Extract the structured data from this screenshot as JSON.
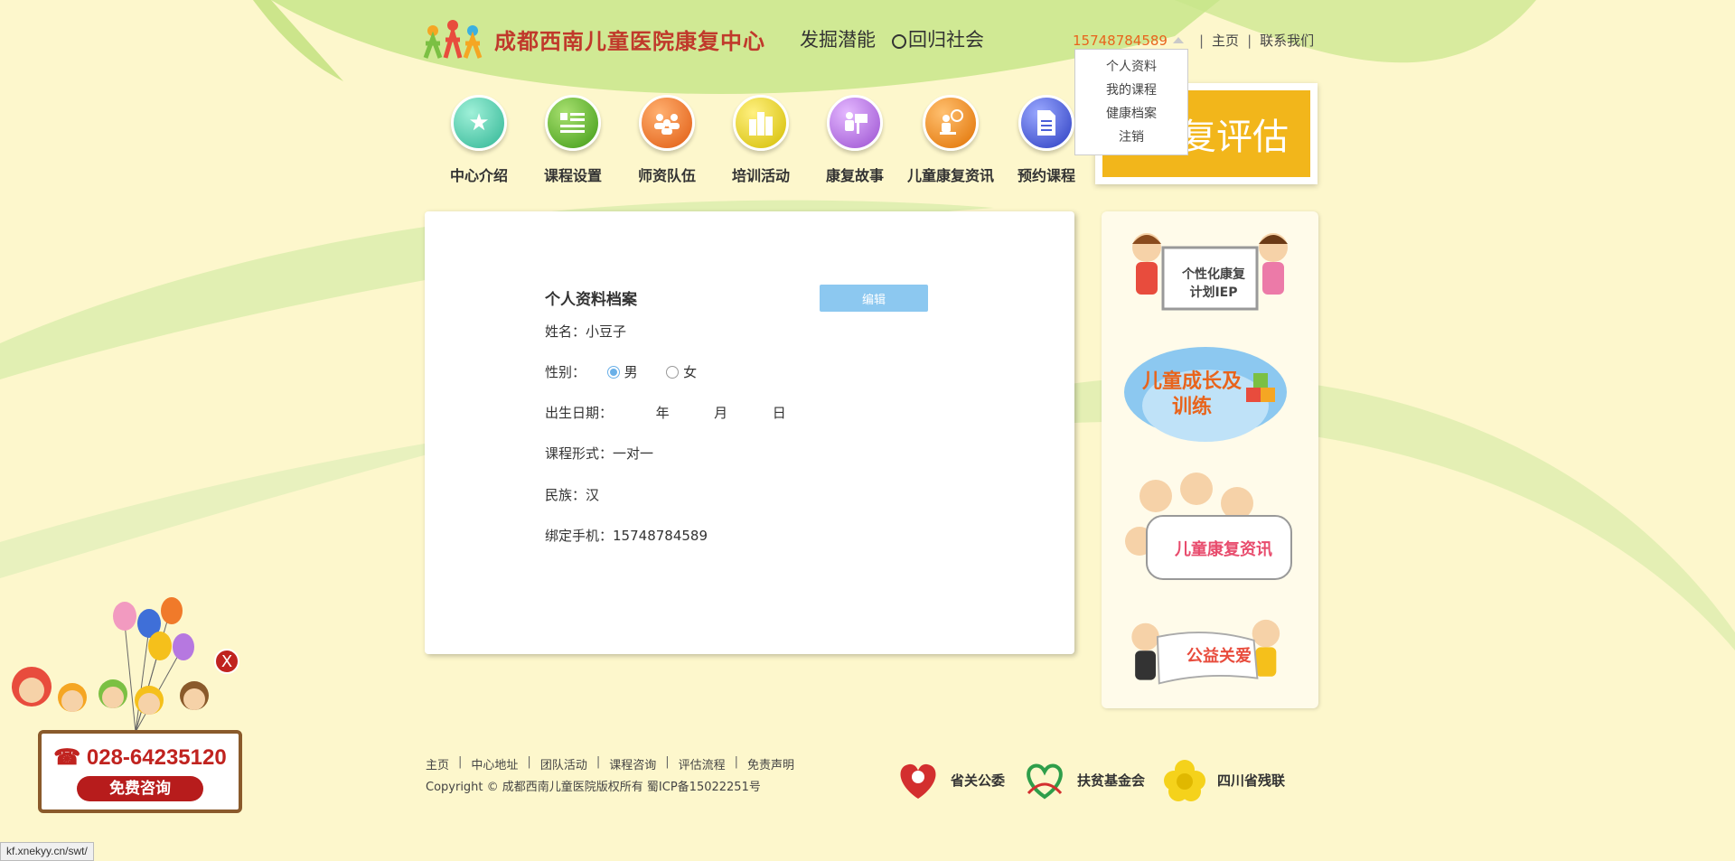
{
  "header": {
    "logo_text": "成都西南儿童医院康复中心",
    "slogan_1": "发掘潜能",
    "slogan_2": "回归社会",
    "phone": "15748784589",
    "home": "主页",
    "contact": "联系我们"
  },
  "dropdown": {
    "items": [
      "个人资料",
      "我的课程",
      "健康档案",
      "注销"
    ]
  },
  "nav": {
    "items": [
      {
        "label": "中心介绍",
        "icon": "star-icon",
        "color": "#4fc9b0"
      },
      {
        "label": "课程设置",
        "icon": "list-icon",
        "color": "#5cb82a"
      },
      {
        "label": "师资队伍",
        "icon": "team-icon",
        "color": "#f07a2a"
      },
      {
        "label": "培训活动",
        "icon": "building-icon",
        "color": "#e6d21a"
      },
      {
        "label": "康复故事",
        "icon": "story-icon",
        "color": "#b678e0"
      },
      {
        "label": "儿童康复资讯",
        "icon": "person-clock-icon",
        "color": "#f08a1a"
      },
      {
        "label": "预约课程",
        "icon": "document-icon",
        "color": "#4a5fd8"
      }
    ]
  },
  "banner": {
    "text": "复评估"
  },
  "profile": {
    "title": "个人资料档案",
    "edit_label": "编辑",
    "name_label": "姓名：",
    "name_value": "小豆子",
    "gender_label": "性别：",
    "gender_male": "男",
    "gender_female": "女",
    "gender_selected": "男",
    "birth_label": "出生日期：",
    "year": "年",
    "month": "月",
    "day": "日",
    "course_label": "课程形式：",
    "course_value": "一对一",
    "ethnicity_label": "民族：",
    "ethnicity_value": "汉",
    "phone_label": "绑定手机：",
    "phone_value": "15748784589"
  },
  "sidebar": {
    "cards": [
      {
        "title": "个性化康复计划IEP"
      },
      {
        "title": "儿童成长及训练"
      },
      {
        "title": "儿童康复资讯"
      },
      {
        "title": "公益关爱"
      }
    ]
  },
  "float_ad": {
    "close": "X",
    "tel": "028-64235120",
    "consult": "免费咨询"
  },
  "footer": {
    "links": [
      "主页",
      "中心地址",
      "团队活动",
      "课程咨询",
      "评估流程",
      "免责声明"
    ],
    "copyright": "Copyright © 成都西南儿童医院版权所有 蜀ICP备15022251号",
    "partners": [
      "省关公委",
      "扶贫基金会",
      "四川省残联"
    ]
  },
  "status_url": "kf.xnekyy.cn/swt/"
}
